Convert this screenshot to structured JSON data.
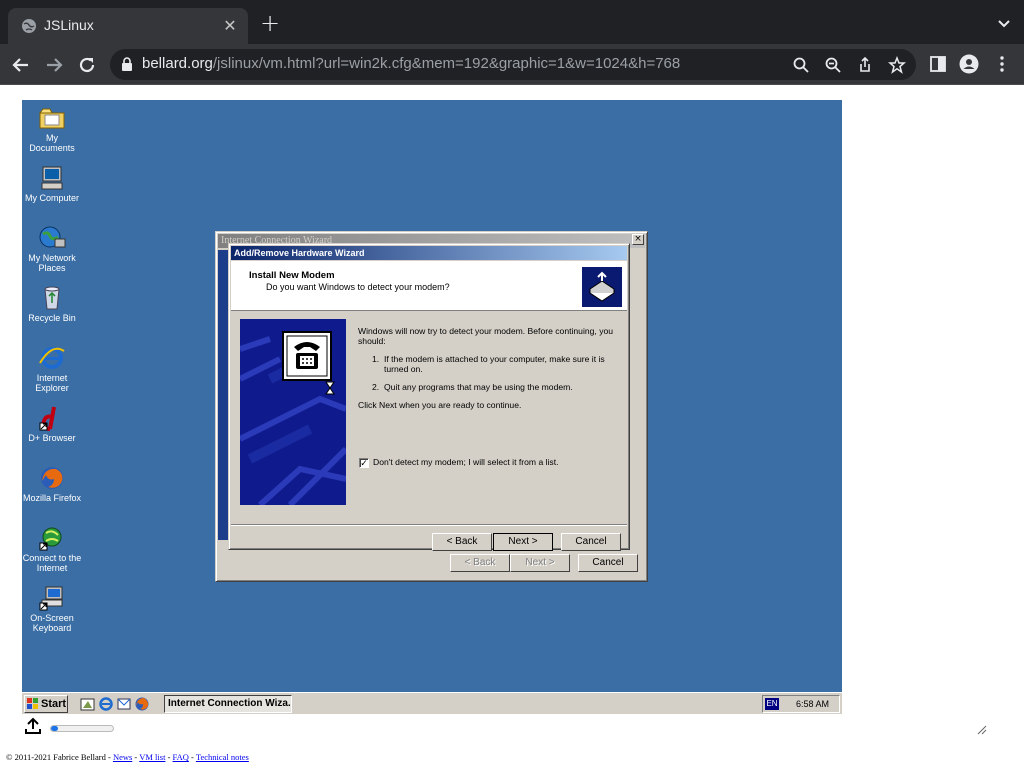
{
  "browser": {
    "tab_title": "JSLinux",
    "url_host": "bellard.org",
    "url_path": "/jslinux/vm.html?url=win2k.cfg&mem=192&graphic=1&w=1024&h=768"
  },
  "desktop": {
    "icons": [
      {
        "label": "My Documents"
      },
      {
        "label": "My Computer"
      },
      {
        "label": "My Network Places"
      },
      {
        "label": "Recycle Bin"
      },
      {
        "label": "Internet Explorer"
      },
      {
        "label": "D+ Browser"
      },
      {
        "label": "Mozilla Firefox"
      },
      {
        "label": "Connect to the Internet"
      },
      {
        "label": "On-Screen Keyboard"
      }
    ]
  },
  "back_window": {
    "title": "Internet Connection Wizard",
    "back_label": "< Back",
    "next_label": "Next >",
    "cancel_label": "Cancel"
  },
  "wizard": {
    "title": "Add/Remove Hardware Wizard",
    "header_title": "Install New Modem",
    "header_subtitle": "Do you want Windows to detect your modem?",
    "intro": "Windows will now try to detect your modem.  Before continuing, you should:",
    "step1_num": "1.",
    "step1": "If the modem is attached to your computer, make sure it is turned on.",
    "step2_num": "2.",
    "step2": "Quit any programs that may be using the modem.",
    "click_next": "Click Next when you are ready to continue.",
    "checkbox_label": "Don't detect my modem; I will select it from a list.",
    "checkbox_checked": true,
    "back_label": "< Back",
    "next_label": "Next >",
    "cancel_label": "Cancel"
  },
  "taskbar": {
    "start_label": "Start",
    "task_label": "Internet Connection Wiza...",
    "lang": "EN",
    "clock": "6:58 AM"
  },
  "page": {
    "upload_progress": 0.12,
    "footer_copyright": "© 2011-2021 Fabrice Bellard - ",
    "footer_links": [
      "News",
      "VM list",
      "FAQ",
      "Technical notes"
    ]
  },
  "colors": {
    "desktop": "#3a6ea5",
    "titlebar_active": "#0a246a",
    "chrome_dark": "#202124"
  }
}
